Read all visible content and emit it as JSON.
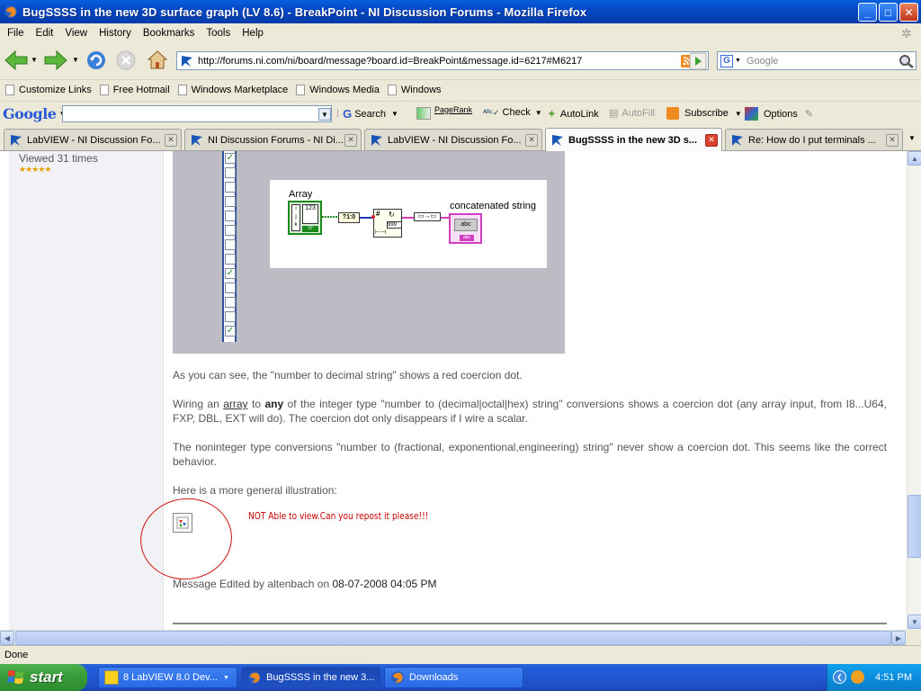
{
  "window": {
    "title": "BugSSSS in the new 3D surface graph (LV 8.6) - BreakPoint - NI Discussion Forums - Mozilla Firefox",
    "buttons": {
      "minimize": "_",
      "maximize": "□",
      "close": "✕"
    }
  },
  "menu": [
    "File",
    "Edit",
    "View",
    "History",
    "Bookmarks",
    "Tools",
    "Help"
  ],
  "nav": {
    "url": "http://forums.ni.com/ni/board/message?board.id=BreakPoint&message.id=6217#M6217",
    "search_placeholder": "Google",
    "search_engine_letter": "G"
  },
  "bookmarks": [
    "Customize Links",
    "Free Hotmail",
    "Windows Marketplace",
    "Windows Media",
    "Windows"
  ],
  "google_toolbar": {
    "logo": "Google",
    "search_label": "Search",
    "pagerank_label": "PageRank",
    "check_label": "Check",
    "autolink_label": "AutoLink",
    "autofill_label": "AutoFill",
    "subscribe_label": "Subscribe",
    "options_label": "Options"
  },
  "tabs": [
    {
      "label": "LabVIEW - NI Discussion Fo...",
      "active": false
    },
    {
      "label": "NI Discussion Forums - NI Di...",
      "active": false
    },
    {
      "label": "LabVIEW - NI Discussion Fo...",
      "active": false
    },
    {
      "label": "BugSSSS in the new 3D s...",
      "active": true
    },
    {
      "label": "Re: How do I put terminals ...",
      "active": false
    }
  ],
  "sidebar": {
    "viewed": "Viewed 31 times",
    "stars": "★★★★★"
  },
  "diagram": {
    "array_label": "Array",
    "numeric_label": "123",
    "concat_label": "concatenated string",
    "index_label": "?1:0",
    "const_label": "999",
    "string_label": "abc"
  },
  "post": {
    "p1": "As you can see, the \"number to decimal string\" shows a red coercion dot.",
    "p2_before_array": "Wiring an ",
    "p2_array": "array",
    "p2_to": " to ",
    "p2_any": "any",
    "p2_rest": " of the integer type \"number to (decimal|octal|hex) string\" conversions shows a coercion dot (any array input, from I8...U64, FXP, DBL, EXT will do). The coercion dot only disappears if I wire a scalar.",
    "p3": "The noninteger type conversions \"number to (fractional, exponentional,engineering) string\" never show a coercion dot. This seems like the correct behavior.",
    "p4": "Here is a more general illustration:",
    "annotation": "NOT Able to view.Can you repost it please!!!",
    "edited_by": "Message Edited by altenbach on ",
    "edited_date": "08-07-2008 04:05 PM"
  },
  "status": "Done",
  "taskbar": {
    "start": "start",
    "items": [
      {
        "label": "8 LabVIEW 8.0 Dev...",
        "active": false
      },
      {
        "label": "BugSSSS in the new 3...",
        "active": true
      },
      {
        "label": "Downloads",
        "active": false
      }
    ],
    "time": "4:51 PM"
  },
  "colors": {
    "title_blue": "#0548c4",
    "annotation_red": "#c80000",
    "taskbar_blue": "#245edb",
    "start_green": "#3a9e3a"
  }
}
